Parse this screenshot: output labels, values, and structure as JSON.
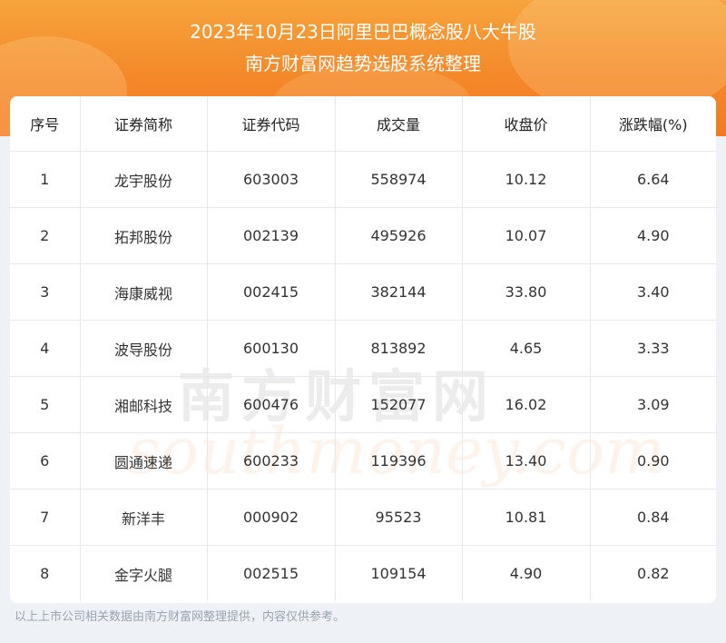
{
  "header": {
    "line1": "2023年10月23日阿里巴巴概念股八大牛股",
    "line2": "南方财富网趋势选股系统整理"
  },
  "table": {
    "columns": [
      "序号",
      "证券简称",
      "证券代码",
      "成交量",
      "收盘价",
      "涨跌幅(%)"
    ],
    "rows": [
      [
        "1",
        "龙宇股份",
        "603003",
        "558974",
        "10.12",
        "6.64"
      ],
      [
        "2",
        "拓邦股份",
        "002139",
        "495926",
        "10.07",
        "4.90"
      ],
      [
        "3",
        "海康威视",
        "002415",
        "382144",
        "33.80",
        "3.40"
      ],
      [
        "4",
        "波导股份",
        "600130",
        "813892",
        "4.65",
        "3.33"
      ],
      [
        "5",
        "湘邮科技",
        "600476",
        "152077",
        "16.02",
        "3.09"
      ],
      [
        "6",
        "圆通速递",
        "600233",
        "119396",
        "13.40",
        "0.90"
      ],
      [
        "7",
        "新洋丰",
        "000902",
        "95523",
        "10.81",
        "0.84"
      ],
      [
        "8",
        "金字火腿",
        "002515",
        "109154",
        "4.90",
        "0.82"
      ]
    ]
  },
  "watermark": {
    "cn": "南方财富网",
    "en": "southmoney.com"
  },
  "footer": {
    "disclaimer": "以上上市公司相关数据由南方财富网整理提供，内容仅供参考。"
  }
}
